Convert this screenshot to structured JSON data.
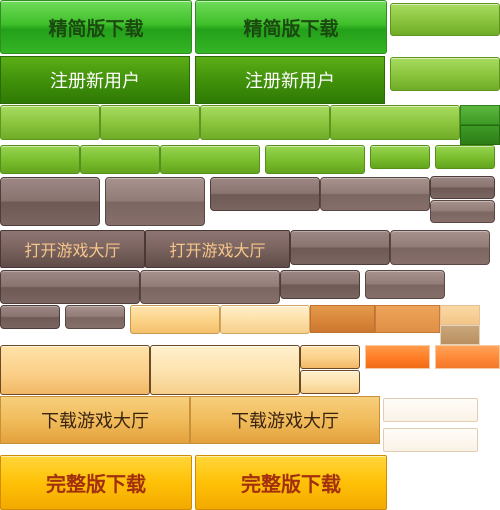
{
  "labels": {
    "jingjian_download": "精简版下载",
    "register_user": "注册新用户",
    "open_game_hall": "打开游戏大厅",
    "download_game_hall": "下载游戏大厅",
    "full_download": "完整版下载"
  }
}
